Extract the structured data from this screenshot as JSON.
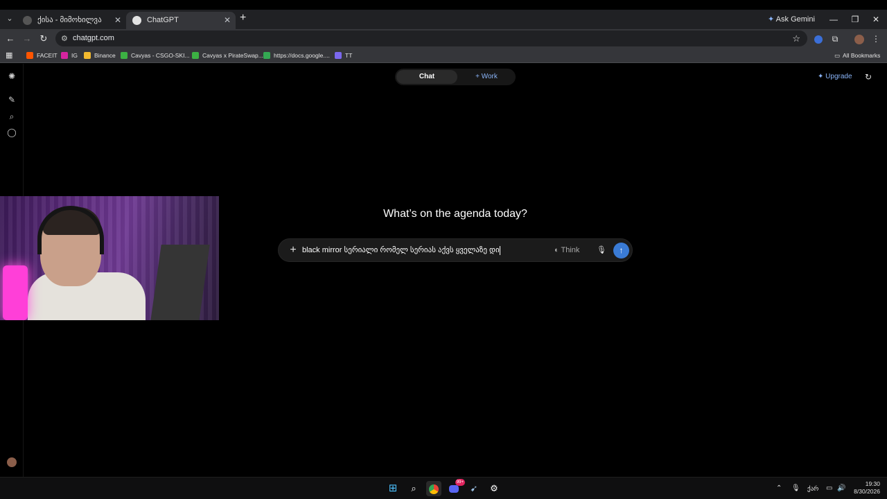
{
  "browser": {
    "tabs": [
      {
        "title": "ქისა - მიმოხილვა",
        "active": false
      },
      {
        "title": "ChatGPT",
        "active": true
      }
    ],
    "new_tab": "+",
    "ask_gemini": "Ask Gemini",
    "window_controls": {
      "minimize": "—",
      "restore": "❐",
      "close": "✕"
    },
    "url": "chatgpt.com",
    "bookmarks": [
      {
        "label": "FACEIT",
        "color": "#ff5500"
      },
      {
        "label": "IG",
        "color": "#d6249f"
      },
      {
        "label": "Binance",
        "color": "#f3ba2f"
      },
      {
        "label": "Cavyas - CSGO-SKI...",
        "color": "#3cb043"
      },
      {
        "label": "Cavyas x PirateSwap...",
        "color": "#3cb043"
      },
      {
        "label": "https://docs.google....",
        "color": "#34a853"
      },
      {
        "label": "TT",
        "color": "#7b68ee"
      }
    ],
    "all_bookmarks": "All Bookmarks"
  },
  "chatgpt": {
    "modes": {
      "chat": "Chat",
      "work": "+ Work"
    },
    "upgrade": "Upgrade",
    "heading": "What’s on the agenda today?",
    "composer": {
      "value": "black mirror სერიალი რომელ სერიას აქვს ყველაზე დი",
      "think_label": "Think"
    }
  },
  "taskbar": {
    "discord_badge": "99+",
    "tray_lang": "ქარ",
    "time": "19:30",
    "date": "8/30/2026"
  },
  "colors": {
    "accent": "#3a7bd5",
    "link": "#8ab4f8",
    "background": "#000000"
  }
}
